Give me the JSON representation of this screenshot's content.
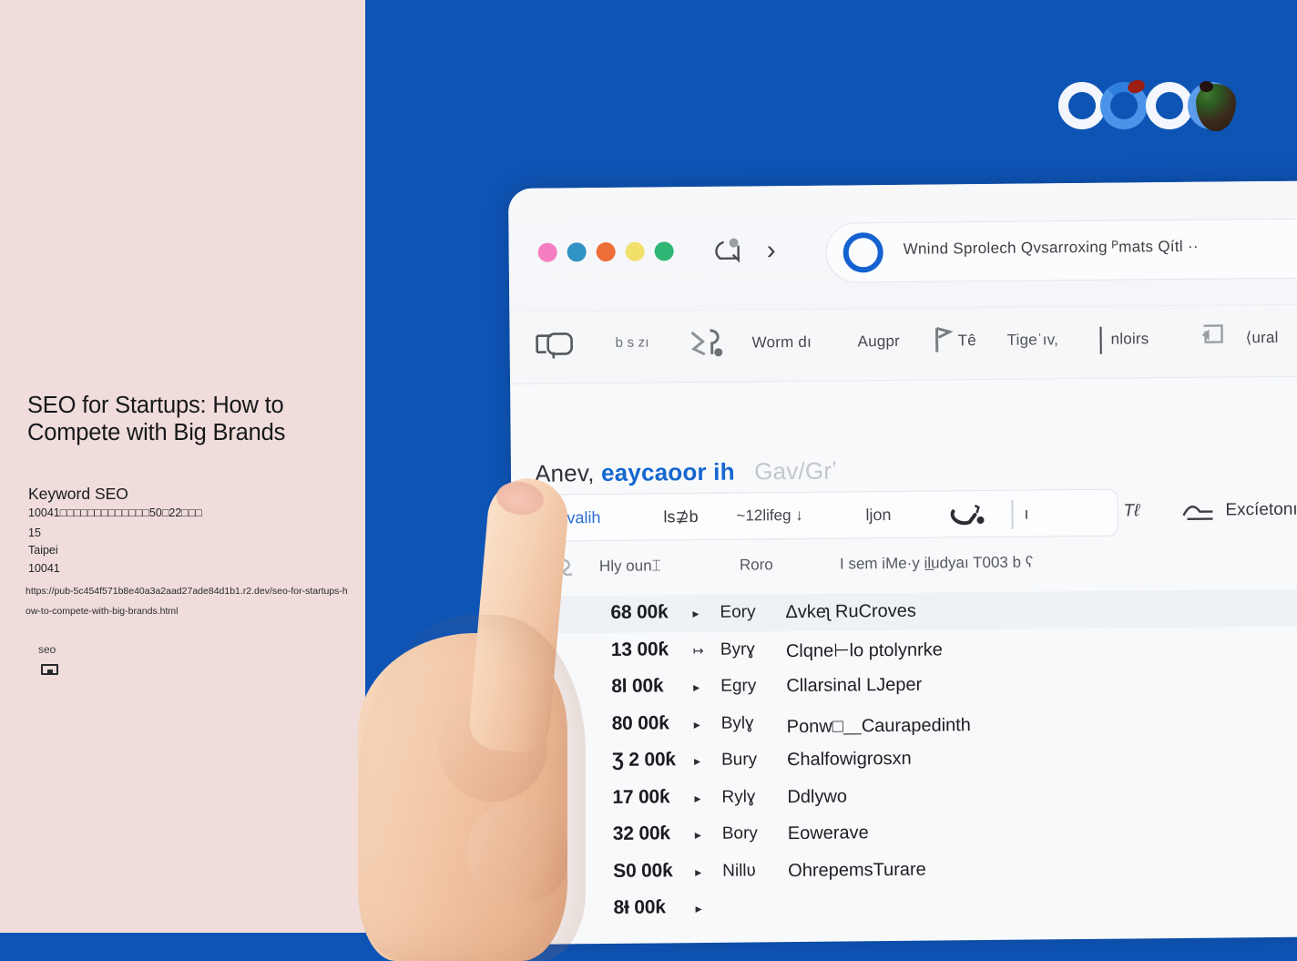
{
  "colors": {
    "page_background": "#0e54b5",
    "left_panel_background": "#efdcdb",
    "browser_chrome": "#f8f9fb",
    "accent_blue": "#1667cf",
    "row_stripe": "#f1f4f8"
  },
  "left_panel": {
    "title": "SEO for Startups: How to Compete with Big Brands",
    "subtitle": "Keyword SEO",
    "address_line": "10041□□□□□□□□□□□□□50□22□□□",
    "number": "15",
    "city": "Taipei",
    "zip": "10041",
    "url": "https://pub-5c454f571b8e40a3a2aad27ade84d1b1.r2.dev/seo-for-startups-how-to-compete-with-big-brands.html",
    "tag": "seo",
    "tag_glyph_icon": "tofu-box-icon"
  },
  "brand_logo": {
    "icon": "brand-rings-logo",
    "ring_count": 4,
    "accent_red": "#9b1d14",
    "accent_green": "#3f7a2e"
  },
  "browser": {
    "traffic_lights": [
      {
        "name": "pink-dot",
        "color": "#f57ec0"
      },
      {
        "name": "blue-dot",
        "color": "#3192c4"
      },
      {
        "name": "orange-dot",
        "color": "#ee6e37"
      },
      {
        "name": "yellow-dot",
        "color": "#f2e06a"
      },
      {
        "name": "green-dot",
        "color": "#2fb574"
      }
    ],
    "nav": {
      "back_icon": "back-arrow-icon",
      "forward_icon": "chevron-right-icon",
      "forward_glyph": "›"
    },
    "omnibox": {
      "circle_icon": "blue-circle-icon",
      "text": "Wnind Sprolech Qvsarroxing ᴾmats Qítl ··"
    },
    "toolbar": [
      {
        "type": "icon",
        "name": "toolbar-icon-0",
        "label": "bracket-shape-icon"
      },
      {
        "type": "text",
        "name": "toolbar-item-1",
        "label": "b s zı"
      },
      {
        "type": "icon",
        "name": "toolbar-icon-2",
        "label": "scribble-icon"
      },
      {
        "type": "text",
        "name": "toolbar-item-3",
        "label": "Worm dı"
      },
      {
        "type": "text",
        "name": "toolbar-item-4",
        "label": "Augpr"
      },
      {
        "type": "icon",
        "name": "toolbar-icon-5",
        "label": "flag-icon"
      },
      {
        "type": "text",
        "name": "toolbar-item-6",
        "label": "Tê"
      },
      {
        "type": "text",
        "name": "toolbar-item-7",
        "label": "Tigeˈıv,"
      },
      {
        "type": "text",
        "name": "toolbar-item-8",
        "label": "nloirs"
      },
      {
        "type": "icon",
        "name": "toolbar-icon-9",
        "label": "bracket-arrow-icon"
      },
      {
        "type": "text",
        "name": "toolbar-item-10",
        "label": "⟨ural"
      },
      {
        "type": "icon",
        "name": "toolbar-icon-11",
        "label": "panel-shape-icon"
      }
    ]
  },
  "page": {
    "heading": {
      "part_dark": "Anev,",
      "part_blue": "eaycaoor ih",
      "part_muted": "Gav/Grʽ"
    },
    "filter_bar": {
      "items": [
        {
          "name": "filter-item-active",
          "label": "hvalih"
        },
        {
          "name": "filter-item-1",
          "label": "ls⊉b"
        },
        {
          "name": "filter-item-2",
          "label": "~12lifeg ↓"
        },
        {
          "name": "filter-item-3",
          "label": "ljon"
        },
        {
          "name": "filter-icon-4",
          "label": "lasso-badge-icon"
        },
        {
          "name": "filter-item-5",
          "label": "ı"
        }
      ]
    },
    "filter_right": {
      "items": [
        {
          "name": "filter-right-item-0",
          "label": "Tℓ"
        },
        {
          "name": "filter-right-icon-1",
          "label": "wave-icon"
        },
        {
          "name": "filter-right-item-2",
          "label": "Excíetonı"
        }
      ]
    },
    "table": {
      "header_icon": "sort-handle-icon",
      "headers": [
        "Hly oun⌶",
        "Roro",
        "I sem iMe·y il̲udyaı T003 b ʕ"
      ],
      "rows": [
        {
          "value": "68 00ƙ",
          "arrow": "▸",
          "tag": "Eory",
          "label": "Δvkeʅ  RuCroves"
        },
        {
          "value": "13 00ƙ",
          "arrow": "↦",
          "tag": "Byrɣ",
          "label": "Clqne⊢lo ptolynrke"
        },
        {
          "value": "8l  00ƙ",
          "arrow": "▸",
          "tag": "Egry",
          "label": "Cllarsinal LJeper"
        },
        {
          "value": "80 00ƙ",
          "arrow": "▸",
          "tag": "Bylɣ",
          "label": "Ponw□⸏Caurapedinth"
        },
        {
          "value": "Ʒ 2 00ƙ",
          "arrow": "▸",
          "tag": "Bury",
          "label": "Єhalfowigrosxn"
        },
        {
          "value": "17 00ƙ",
          "arrow": "▸",
          "tag": "Rylɣ",
          "label": "Ddlywo"
        },
        {
          "value": "32 00ƙ",
          "arrow": "▸",
          "tag": "Bory",
          "label": "Eowerave"
        },
        {
          "value": "S0 00ƙ",
          "arrow": "▸",
          "tag": "Nillʋ",
          "label": "OhrepemsTurare"
        },
        {
          "value": "8Ɨ 00ƙ",
          "arrow": "▸",
          "tag": "",
          "label": ""
        }
      ]
    }
  },
  "hand": {
    "name": "pointing-hand",
    "gesture": "index-finger-pointing-up"
  }
}
